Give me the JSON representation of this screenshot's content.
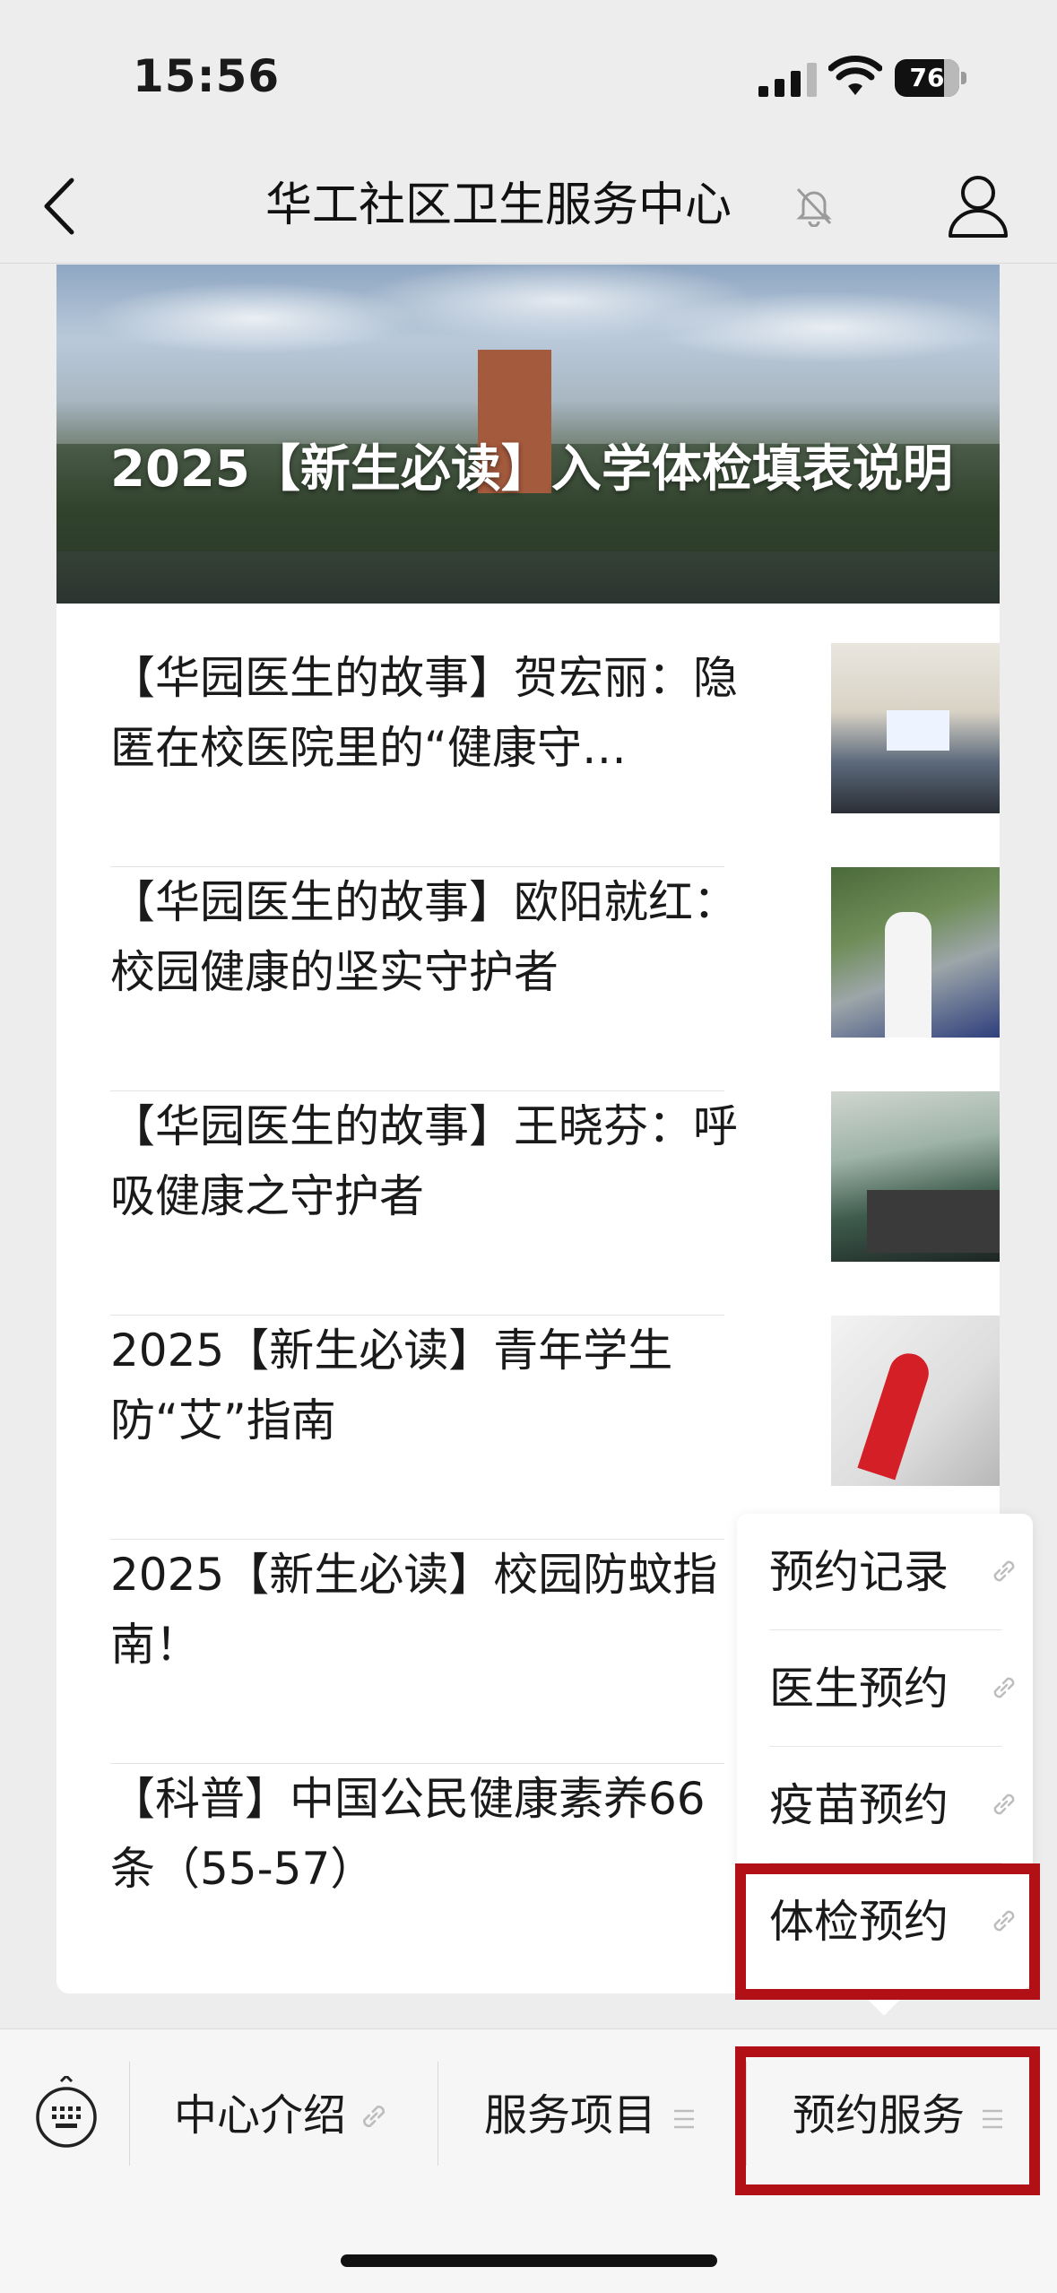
{
  "status": {
    "time": "15:56",
    "battery": "76",
    "battery_level": 0.76
  },
  "nav": {
    "title": "华工社区卫生服务中心",
    "icons": [
      "back-icon",
      "mute-bell-icon",
      "profile-icon"
    ]
  },
  "hero": {
    "title": "2025【新生必读】入学体检填表说明"
  },
  "articles": [
    {
      "title": "【华园医生的故事】贺宏丽：隐匿在校医院里的“健康守…",
      "thumb": "lecture-room-photo"
    },
    {
      "title": "【华园医生的故事】欧阳就红：校园健康的坚实守护者",
      "thumb": "doctor-speaking-photo"
    },
    {
      "title": "【华园医生的故事】王晓芬：呼吸健康之守护者",
      "thumb": "clinic-desk-photo"
    },
    {
      "title": "2025【新生必读】青年学生防“艾”指南",
      "thumb": "red-ribbon-photo"
    },
    {
      "title": "2025【新生必读】校园防蚊指南！",
      "thumb": ""
    },
    {
      "title": "【科普】中国公民健康素养66条（55-57）",
      "thumb": ""
    }
  ],
  "popup": {
    "items": [
      {
        "label": "预约记录",
        "icon": "link-icon"
      },
      {
        "label": "医生预约",
        "icon": "link-icon"
      },
      {
        "label": "疫苗预约",
        "icon": "link-icon"
      },
      {
        "label": "体检预约",
        "icon": "link-icon"
      }
    ]
  },
  "bottom_menu": {
    "items": [
      {
        "label": "中心介绍",
        "icon": "link-icon"
      },
      {
        "label": "服务项目",
        "icon": "menu-lines-icon"
      },
      {
        "label": "预约服务",
        "icon": "menu-lines-icon"
      }
    ]
  },
  "colors": {
    "highlight": "#b01016",
    "background": "#ededed"
  }
}
